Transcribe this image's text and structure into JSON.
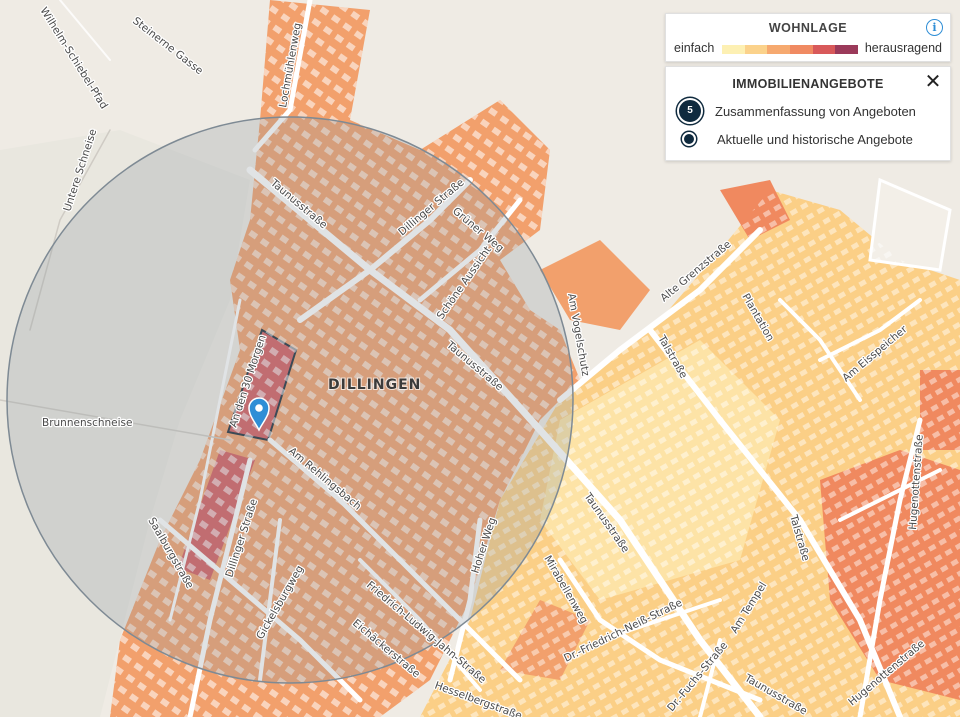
{
  "legend": {
    "title": "WOHNLAGE",
    "low_label": "einfach",
    "high_label": "herausragend",
    "info_icon": "info-icon",
    "scale_colors": [
      "#fdf0b3",
      "#fbd28b",
      "#f6a96f",
      "#f08a62",
      "#d8595a",
      "#9b3a5a"
    ]
  },
  "offers_panel": {
    "title": "IMMOBILIENANGEBOTE",
    "close_icon": "close-icon",
    "items": [
      {
        "marker": "5",
        "label": "Zusammenfassung von Angeboten"
      },
      {
        "marker": "",
        "label": "Aktuelle und historische Angebote"
      }
    ]
  },
  "map": {
    "district": "DILLINGEN",
    "streets": [
      "Wilhelm-Schiebel-Pfad",
      "Steinerne Gasse",
      "Lochmühlenweg",
      "Untere Schneise",
      "Brunnenschneise",
      "Taunusstraße",
      "Dillinger Straße",
      "Grüner Weg",
      "Schöne Aussicht",
      "Am Vogelschutz",
      "Alte Grenzstraße",
      "Plantation",
      "Talstraße",
      "Am Eisspeicher",
      "Hugenottenstraße",
      "An den 30 Morgen",
      "Am Rehlingsbach",
      "Saalburgstraße",
      "Gickelsburgweg",
      "Friedrich-Ludwig-Jahn-Straße",
      "Eichäckerstraße",
      "Hesselbergstraße",
      "Hoher Weg",
      "Mirabellenweg",
      "Dr.-Friedrich-Neiß-Straße",
      "Dr.-Fuchs-Straße",
      "Am Tempel"
    ],
    "colors": {
      "background": "#efebe4",
      "zone_simple": "#fde3a6",
      "zone_medium": "#fbcf86",
      "zone_good": "#f2a06c",
      "zone_very_good": "#f0895f",
      "zone_premium": "#d45c5f",
      "road": "#ffffff",
      "building": "#d6d3cd",
      "radius_fill": "#9aa6ae",
      "marker": "#2f8ed6"
    }
  }
}
